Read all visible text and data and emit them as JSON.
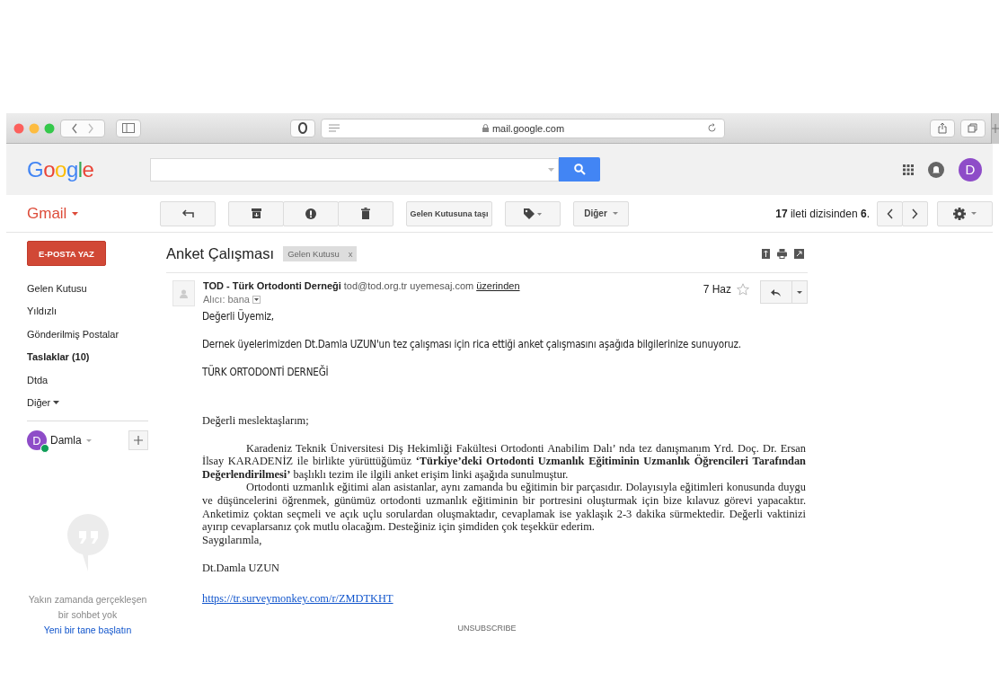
{
  "browser": {
    "url": "mail.google.com"
  },
  "header": {
    "logo": "Google",
    "avatar_initial": "D"
  },
  "gmail_menu": {
    "label": "Gmail"
  },
  "toolbar": {
    "groups": [
      [
        {
          "kind": "reply"
        }
      ],
      [
        {
          "kind": "archive"
        },
        {
          "kind": "spam"
        },
        {
          "kind": "delete"
        }
      ],
      [
        {
          "kind": "move",
          "label": "Gelen Kutusuna taşı"
        }
      ],
      [
        {
          "kind": "labels"
        }
      ],
      [
        {
          "kind": "more",
          "label": "Diğer"
        }
      ]
    ],
    "pagination": "**17** ileti dizisinden **6**."
  },
  "sidebar": {
    "compose": "E-POSTA YAZ",
    "items": [
      {
        "label": "Gelen Kutusu",
        "unread": false,
        "selected": false,
        "has_menu": false
      },
      {
        "label": "Yıldızlı",
        "unread": false,
        "selected": false,
        "has_menu": false
      },
      {
        "label": "Gönderilmiş Postalar",
        "unread": false,
        "selected": false,
        "has_menu": false
      },
      {
        "label": "Taslaklar (10)",
        "unread": true,
        "selected": false,
        "has_menu": false
      },
      {
        "label": "Dtda",
        "unread": false,
        "selected": false,
        "has_menu": false
      },
      {
        "label": "Diğer",
        "unread": false,
        "selected": false,
        "has_menu": true
      }
    ],
    "account": {
      "initial": "D",
      "name": "Damla",
      "online": true
    },
    "chat": {
      "empty_lines": [
        "Yakın zamanda gerçekleşen",
        "bir sohbet yok"
      ],
      "start_link": "Yeni bir tane başlatın"
    }
  },
  "message": {
    "subject": "Anket Çalışması",
    "label": "Gelen Kutusu",
    "label_remove": "x",
    "sender_name": "TOD - Türk Ortodonti Derneği",
    "sender_email": "tod@tod.org.tr",
    "via_domain": "uyemesaj.com",
    "via_link": "üzerinden",
    "recipient": "Alıcı: bana",
    "date": "7 Haz",
    "starred": false,
    "body": [
      {
        "kind": "sans",
        "text": "Değerli Üyemiz,"
      },
      {
        "kind": "sans",
        "text": "Dernek üyelerimizden Dt.Damla UZUN'un tez çalışması için rica ettiği anket çalışmasını aşağıda bilgilerinize sunuyoruz."
      },
      {
        "kind": "sans",
        "text": "TÜRK ORTODONTİ DERNEĞİ"
      },
      {
        "kind": "salutation",
        "text": "Değerli meslektaşlarım;"
      },
      {
        "kind": "indent",
        "text": "Karadeniz Teknik Üniversitesi Diş Hekimliği Fakültesi Ortodonti Anabilim Dalı’ nda tez danışmanım Yrd. Doç. Dr. Ersan İlsay KARADENİZ ile birlikte yürüttüğümüz **‘Türkiye’deki Ortodonti Uzmanlık Eğitiminin Uzmanlık Öğrencileri Tarafından Değerlendirilmesi’** başlıklı tezim ile ilgili anket erişim linki aşağıda sunulmuştur."
      },
      {
        "kind": "indent",
        "text": "Ortodonti uzmanlık eğitimi alan asistanlar, aynı zamanda bu eğitimin bir parçasıdır. Dolayısıyla eğitimleri konusunda duygu ve düşüncelerini öğrenmek, günümüz ortodonti uzmanlık eğitiminin bir portresini oluşturmak için bize kılavuz görevi yapacaktır. Anketimiz çoktan seçmeli ve açık uçlu sorulardan oluşmaktadır, cevaplamak ise yaklaşık 2-3 dakika sürmektedir. Değerli vaktinizi ayırıp cevaplarsanız çok mutlu olacağım. Desteğiniz için şimdiden çok teşekkür ederim."
      },
      {
        "kind": "closing",
        "text": "Saygılarımla,"
      },
      {
        "kind": "signature",
        "text": "Dt.Damla UZUN"
      },
      {
        "kind": "link",
        "text": "https://tr.surveymonkey.com/r/ZMDTKHT"
      }
    ],
    "unsubscribe": "UNSUBSCRIBE"
  }
}
